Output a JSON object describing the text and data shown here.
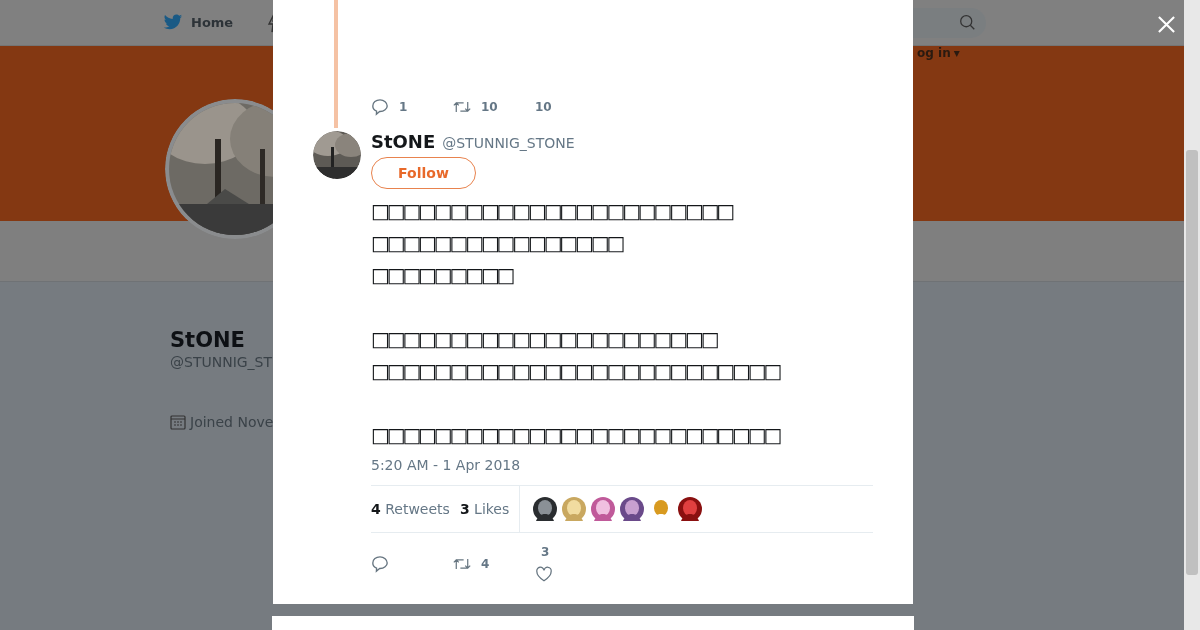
{
  "background_page": {
    "nav": {
      "home": "Home",
      "login": "og in",
      "login_caret": "▾"
    },
    "profile": {
      "name": "StONE",
      "handle": "@STUNNIG_ST",
      "joined": "Joined Nove"
    }
  },
  "previous_tweet": {
    "replies": "1",
    "retweets": "10",
    "likes": "10"
  },
  "tweet": {
    "name": "StONE",
    "handle": "@STUNNIG_STONE",
    "follow": "Follow",
    "paragraphs": [
      [
        "□□□□□□□□□□□□□□□□□□□□□□□",
        "□□□□□□□□□□□□□□□□",
        "□□□□□□□□□"
      ],
      [
        "□□□□□□□□□□□□□□□□□□□□□□",
        "□□□□□□□□□□□□□□□□□□□□□□□□□□"
      ],
      [
        "□□□□□□□□□□□□□□□□□□□□□□□□□□"
      ]
    ],
    "time": "5:20 AM - 1 Apr 2018",
    "stats": [
      {
        "count": "4",
        "label": "Retweets"
      },
      {
        "count": "3",
        "label": "Likes"
      }
    ],
    "likers": [
      {
        "kind": "picture"
      },
      {
        "kind": "picture"
      },
      {
        "kind": "picture"
      },
      {
        "kind": "picture"
      },
      {
        "kind": "picture"
      },
      {
        "kind": "picture"
      }
    ],
    "actions": {
      "retweets": "4",
      "likes": "3"
    }
  }
}
